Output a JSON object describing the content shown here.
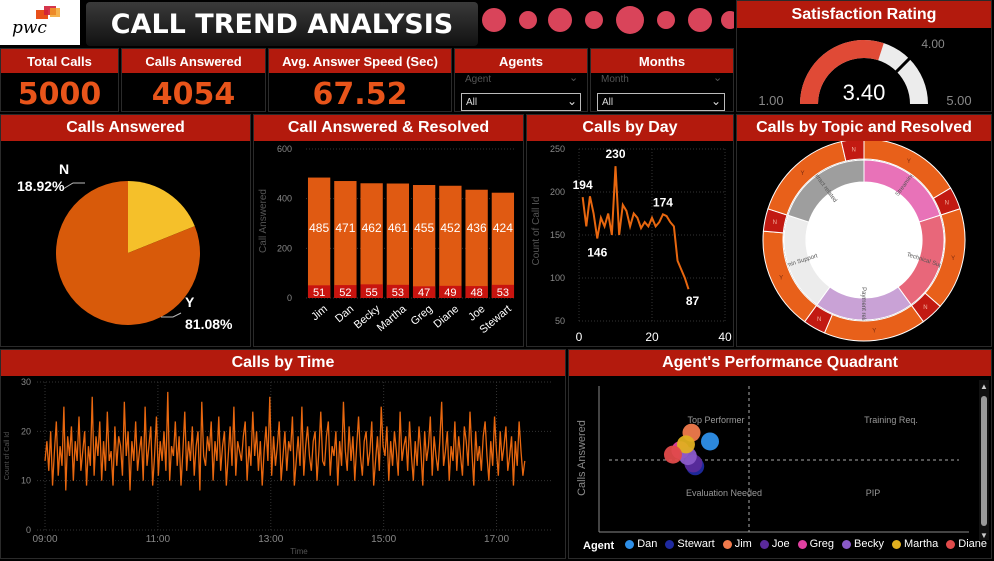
{
  "brand": {
    "logo_text": "pwc"
  },
  "title": "CALL TREND ANALYSIS",
  "kpis": [
    {
      "label": "Total Calls",
      "value": "5000"
    },
    {
      "label": "Calls Answered",
      "value": "4054"
    },
    {
      "label": "Avg. Answer Speed (Sec)",
      "value": "67.52"
    }
  ],
  "slicers": {
    "agents": {
      "label": "Agents",
      "placeholder": "Agent",
      "value": "All"
    },
    "months": {
      "label": "Months",
      "placeholder": "Month",
      "value": "All"
    }
  },
  "satisfaction": {
    "title": "Satisfaction Rating",
    "value": 3.4,
    "value_label": "3.40",
    "min": 1.0,
    "max": 5.0,
    "target": 4.0,
    "min_label": "1.00",
    "max_label": "5.00",
    "target_label": "4.00"
  },
  "calls_answered_pie": {
    "title": "Calls Answered",
    "chart_data": {
      "type": "pie",
      "slices": [
        {
          "label": "Y",
          "percent": 81.08,
          "percent_label": "81.08%",
          "color": "#d85a0a"
        },
        {
          "label": "N",
          "percent": 18.92,
          "percent_label": "18.92%",
          "color": "#f5c02a"
        }
      ]
    }
  },
  "answered_resolved": {
    "title": "Call Answered & Resolved",
    "chart_data": {
      "type": "bar",
      "ylabel": "Call Answered",
      "ylim": [
        0,
        600
      ],
      "yticks": [
        "0",
        "200",
        "400",
        "600"
      ],
      "categories": [
        "Jim",
        "Dan",
        "Becky",
        "Martha",
        "Greg",
        "Diane",
        "Joe",
        "Stewart"
      ],
      "series": [
        {
          "values": [
            485,
            471,
            462,
            461,
            455,
            452,
            436,
            424
          ],
          "color": "#e05a12"
        },
        {
          "values": [
            51,
            52,
            55,
            53,
            47,
            49,
            48,
            53
          ],
          "color": "#c8140f"
        }
      ]
    }
  },
  "calls_by_day": {
    "title": "Calls by Day",
    "chart_data": {
      "type": "line",
      "ylabel": "Count of Call Id",
      "xlim": [
        0,
        40
      ],
      "ylim": [
        50,
        250
      ],
      "xticks": [
        "0",
        "20",
        "40"
      ],
      "yticks": [
        "50",
        "100",
        "150",
        "200",
        "250"
      ],
      "x": [
        1,
        2,
        3,
        4,
        5,
        6,
        7,
        8,
        9,
        10,
        11,
        12,
        13,
        14,
        15,
        16,
        17,
        18,
        19,
        20,
        21,
        22,
        23,
        24,
        25,
        26,
        27,
        28,
        29,
        30
      ],
      "y": [
        194,
        160,
        195,
        175,
        146,
        170,
        160,
        175,
        150,
        230,
        150,
        185,
        178,
        160,
        175,
        170,
        158,
        165,
        160,
        170,
        160,
        165,
        174,
        172,
        165,
        160,
        120,
        110,
        100,
        87
      ],
      "labels": [
        {
          "x": 1,
          "y": 194,
          "text": "194"
        },
        {
          "x": 10,
          "y": 230,
          "text": "230"
        },
        {
          "x": 5,
          "y": 146,
          "text": "146"
        },
        {
          "x": 23,
          "y": 174,
          "text": "174"
        },
        {
          "x": 30,
          "y": 87,
          "text": "87"
        }
      ],
      "color": "#e8670f"
    }
  },
  "calls_by_topic": {
    "title": "Calls by Topic and Resolved",
    "chart_data": {
      "type": "pie",
      "inner": [
        {
          "label": "Streaming",
          "value": 20,
          "color": "#e872b8"
        },
        {
          "label": "Technical Support",
          "value": 20,
          "color": "#e8677a"
        },
        {
          "label": "Payment related",
          "value": 20,
          "color": "#c9a2d6"
        },
        {
          "label": "Admin Support",
          "value": 20,
          "color": "#ececec"
        },
        {
          "label": "Contract related",
          "value": 20,
          "color": "#9e9e9e"
        }
      ],
      "outer_labels": [
        "N",
        "Y"
      ],
      "outer_colors": {
        "Y": "#e8601a",
        "N": "#c21a12"
      }
    }
  },
  "calls_by_time": {
    "title": "Calls by Time",
    "chart_data": {
      "type": "line",
      "xlabel": "Time",
      "ylabel": "Count of Call Id",
      "ylim": [
        0,
        30
      ],
      "yticks": [
        "0",
        "10",
        "20",
        "30"
      ],
      "xticks": [
        "09:00",
        "11:00",
        "13:00",
        "15:00",
        "17:00"
      ],
      "x_start_hour": 9,
      "x_end_hour": 18,
      "y": [
        14,
        18,
        12,
        20,
        9,
        16,
        22,
        11,
        17,
        13,
        25,
        8,
        19,
        15,
        21,
        10,
        18,
        14,
        23,
        12,
        16,
        20,
        9,
        17,
        13,
        27,
        11,
        19,
        15,
        22,
        10,
        18,
        12,
        24,
        14,
        16,
        9,
        21,
        13,
        19,
        17,
        11,
        26,
        15,
        20,
        8,
        18,
        14,
        22,
        12,
        16,
        19,
        10,
        25,
        13,
        17,
        21,
        9,
        15,
        23,
        11,
        18,
        14,
        20,
        12,
        28,
        10,
        17,
        15,
        22,
        13,
        19,
        9,
        16,
        24,
        12,
        18,
        14,
        21,
        11,
        17,
        20,
        8,
        26,
        15,
        13,
        19,
        16,
        22,
        10,
        18,
        14,
        23,
        12,
        17,
        20,
        9,
        15,
        21,
        13,
        25,
        11,
        18,
        16,
        14,
        19,
        22,
        10,
        17,
        13,
        24,
        15,
        20,
        12,
        18,
        9,
        16,
        21,
        14,
        27,
        11,
        19,
        13,
        17,
        22,
        10,
        15,
        20,
        12,
        18,
        16,
        23,
        9,
        14,
        19,
        13,
        25,
        11,
        17,
        21,
        15,
        12,
        18,
        20,
        10,
        16,
        24,
        14,
        13,
        19,
        22,
        11,
        17,
        15,
        20,
        9,
        18,
        13,
        26,
        16,
        12,
        21,
        14,
        19,
        10,
        17,
        23,
        15,
        11,
        18,
        20,
        13,
        16,
        22,
        9,
        14,
        19,
        12,
        25,
        17,
        15,
        21,
        10,
        18,
        13,
        20,
        16,
        11,
        24,
        14,
        17,
        19,
        12,
        22,
        15,
        10,
        18,
        13,
        21,
        16,
        9,
        20,
        14,
        17,
        23,
        11,
        19,
        15,
        12,
        18,
        26,
        13,
        16,
        20,
        10,
        17,
        14,
        22,
        12,
        19,
        15,
        11,
        21,
        18,
        13,
        24,
        16,
        9,
        20,
        14,
        17,
        12,
        19,
        22,
        15,
        10,
        18,
        13,
        23,
        16,
        11,
        20,
        14,
        17,
        21,
        12,
        15,
        19,
        9,
        18,
        13,
        22,
        16,
        11,
        14
      ],
      "color": "#e8670f"
    }
  },
  "agent_quadrant": {
    "title": "Agent's Performance Quadrant",
    "chart_data": {
      "type": "scatter",
      "ylabel": "Calls Answered",
      "quadrants": [
        "Top Performer",
        "Training Req.",
        "Evaluation Needed",
        "PIP"
      ],
      "legend_title": "Agent",
      "points": [
        {
          "name": "Dan",
          "x": 0.3,
          "y": 0.62,
          "color": "#2e8fe8"
        },
        {
          "name": "Stewart",
          "x": 0.26,
          "y": 0.45,
          "color": "#1f2aa0"
        },
        {
          "name": "Jim",
          "x": 0.25,
          "y": 0.68,
          "color": "#f07a4c"
        },
        {
          "name": "Joe",
          "x": 0.255,
          "y": 0.47,
          "color": "#5a2a9a"
        },
        {
          "name": "Greg",
          "x": 0.22,
          "y": 0.56,
          "color": "#e040a0"
        },
        {
          "name": "Becky",
          "x": 0.24,
          "y": 0.52,
          "color": "#8a5ac8"
        },
        {
          "name": "Martha",
          "x": 0.235,
          "y": 0.6,
          "color": "#e0b020"
        },
        {
          "name": "Diane",
          "x": 0.2,
          "y": 0.53,
          "color": "#e04a4a"
        }
      ]
    }
  }
}
